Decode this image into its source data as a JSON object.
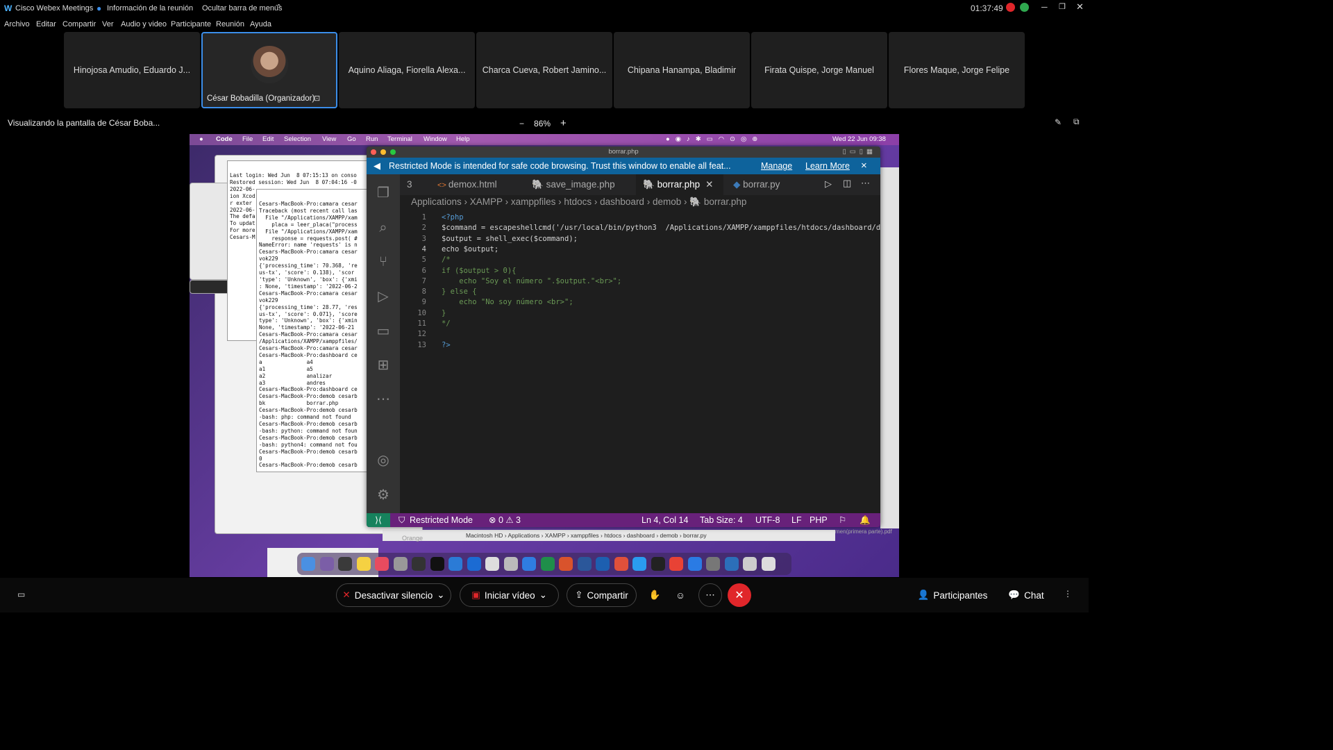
{
  "window": {
    "app_name": "Cisco Webex Meetings",
    "meeting_info": "Información de la reunión",
    "hide_menu": "Ocultar barra de menús",
    "clock": "01:37:49"
  },
  "menu": [
    "Archivo",
    "Editar",
    "Compartir",
    "Ver",
    "Audio y video",
    "Participante",
    "Reunión",
    "Ayuda"
  ],
  "participants": [
    "Hinojosa Amudio, Eduardo J...",
    "César Bobadilla (Organizador)",
    "Aquino Aliaga, Fiorella Alexa...",
    "Charca Cueva, Robert Jamino...",
    "Chipana Hanampa, Bladimir",
    "Firata Quispe, Jorge Manuel",
    "Flores Maque, Jorge Felipe"
  ],
  "viewing": {
    "text": "Visualizando la pantalla de César Boba...",
    "zoom_minus": "−",
    "zoom": "86%",
    "zoom_plus": "+"
  },
  "mac_menu": {
    "apple": "",
    "items": [
      "Code",
      "File",
      "Edit",
      "Selection",
      "View",
      "Go",
      "Run",
      "Terminal",
      "Window",
      "Help"
    ],
    "datetime": "Wed 22 Jun  09:38"
  },
  "terminal1": [
    "Last login: Wed Jun  8 07:15:13 on conso",
    "Restored session: Wed Jun  8 07:04:16 -0",
    "2022-06-",
    "ion Xcod",
    "r exter",
    "2022-06-",
    "",
    "The defa",
    "To updat",
    "For more",
    "Cesars-M"
  ],
  "terminal2": [
    "Cesars-MacBook-Pro:camara cesar",
    "Traceback (most recent call las",
    "  File \"/Applications/XAMPP/xam",
    "    placa = leer_placa(\"process",
    "  File \"/Applications/XAMPP/xam",
    "    response = requests.post( #",
    "NameError: name 'requests' is n",
    "Cesars-MacBook-Pro:camara cesar",
    "vok229",
    "{'processing_time': 70.368, 're",
    "us-tx', 'score': 0.138), 'scor",
    "'type': 'Unknown', 'box': {'xmi",
    ": None, 'timestamp': '2022-06-2",
    "Cesars-MacBook-Pro:camara cesar",
    "vok229",
    "{'processing_time': 28.77, 'res",
    "us-tx', 'score': 0.071}, 'score",
    "type': 'Unknown', 'box': {'xmin",
    "None, 'timestamp': '2022-06-21",
    "Cesars-MacBook-Pro:camara cesar",
    "/Applications/XAMPP/xamppfiles/",
    "Cesars-MacBook-Pro:camara cesar",
    "Cesars-MacBook-Pro:dashboard ce",
    "a              a4",
    "a1             a5",
    "a2             analizar",
    "a3             andres",
    "Cesars-MacBook-Pro:dashboard ce",
    "Cesars-MacBook-Pro:demob cesarb",
    "bk             borrar.php",
    "Cesars-MacBook-Pro:demob cesarb",
    "-bash: php: command not found",
    "Cesars-MacBook-Pro:demob cesarb",
    "-bash: python: command not foun",
    "Cesars-MacBook-Pro:demob cesarb",
    "-bash: python4: command not fou",
    "Cesars-MacBook-Pro:demob cesarb",
    "0",
    "Cesars-MacBook-Pro:demob cesarb"
  ],
  "vscode": {
    "title": "borrar.php",
    "banner": "Restricted Mode is intended for safe code browsing. Trust this window to enable all feat...",
    "manage": "Manage",
    "learn_more": "Learn More",
    "close": "×",
    "tabs": [
      {
        "label": "3",
        "icon": ""
      },
      {
        "label": "demox.html",
        "icon": "<>"
      },
      {
        "label": "save_image.php",
        "icon": "php-icon"
      },
      {
        "label": "borrar.php",
        "icon": "php-icon",
        "active": true
      },
      {
        "label": "borrar.py",
        "icon": "py-icon"
      }
    ],
    "breadcrumbs": [
      "Applications",
      "XAMPP",
      "xamppfiles",
      "htdocs",
      "dashboard",
      "demob",
      "borrar.php"
    ],
    "lines": [
      "<?php",
      "$command = escapeshellcmd('/usr/local/bin/python3  /Applications/XAMPP/xamppfiles/htdocs/dashboard/demo",
      "$output = shell_exec($command);",
      "echo $output;",
      "/*",
      "if ($output > 0){",
      "    echo \"Soy el número \".$output.\"<br>\";",
      "} else {",
      "    echo \"No soy número <br>\";",
      "}",
      "*/",
      "",
      "?>"
    ],
    "status": {
      "mode": "Restricted Mode",
      "errors": "⊗ 0 ⚠ 3",
      "position": "Ln 4, Col 14",
      "tab_size": "Tab Size: 4",
      "encoding": "UTF-8",
      "eol": "LF",
      "language": "PHP"
    }
  },
  "finder_path": "Macintosh HD › Applications › XAMPP › xamppfiles › htdocs › dashboard › demob › borrar.py",
  "finder_tag": "Orange",
  "pdf_label": "men(primera parte).pdf",
  "bottom": {
    "mute": "Desactivar silencio",
    "video": "Iniciar vídeo",
    "share": "Compartir",
    "participants": "Participantes",
    "chat": "Chat"
  },
  "colors": {
    "accent": "#3b8eea",
    "vscode_banner": "#0e639c",
    "vscode_status": "#68217a",
    "end_call": "#e0262a"
  }
}
